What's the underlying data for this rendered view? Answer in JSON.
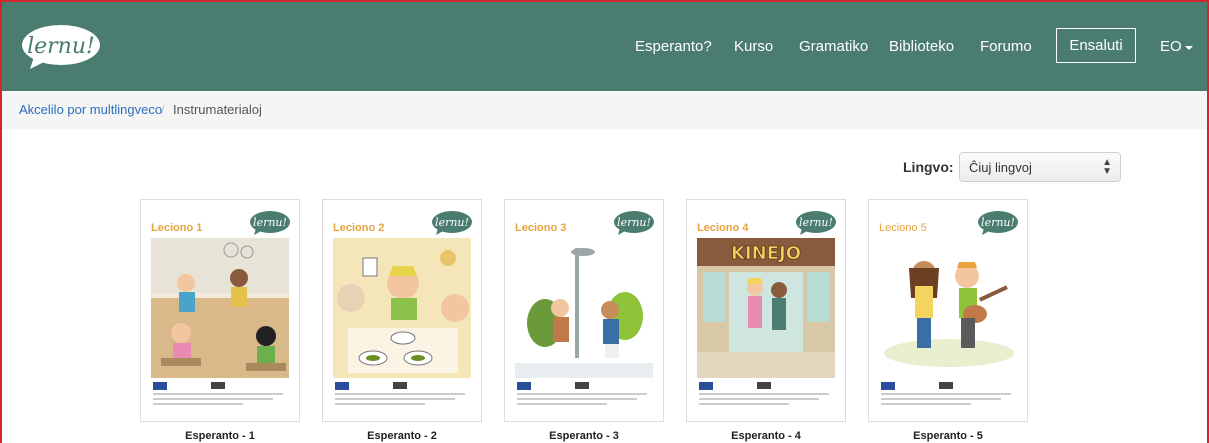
{
  "navbar": {
    "logo_text": "lernu!",
    "links": [
      "Esperanto?",
      "Kurso",
      "Gramatiko",
      "Biblioteko",
      "Forumo"
    ],
    "login_label": "Ensaluti",
    "lang_label": "EO"
  },
  "breadcrumb": {
    "parent": "Akcelilo por multlingveco",
    "separator": "/",
    "current": "Instrumaterialoj"
  },
  "filter": {
    "label": "Lingvo:",
    "selected": "Ĉiuj lingvoj"
  },
  "cards": [
    {
      "lesson": "Leciono 1",
      "caption": "Esperanto - 1",
      "logo": "lernu!"
    },
    {
      "lesson": "Leciono 2",
      "caption": "Esperanto - 2",
      "logo": "lernu!"
    },
    {
      "lesson": "Leciono 3",
      "caption": "Esperanto - 3",
      "logo": "lernu!"
    },
    {
      "lesson": "Leciono 4",
      "caption": "Esperanto - 4",
      "logo": "lernu!",
      "sign": "KINEJO"
    },
    {
      "lesson": "Leciono 5",
      "caption": "Esperanto - 5",
      "logo": "lernu!"
    }
  ],
  "colors": {
    "navbar": "#4a7c70",
    "link": "#2a6ebb",
    "lesson_title": "#e8a33c",
    "frame_border": "#d0282c"
  }
}
